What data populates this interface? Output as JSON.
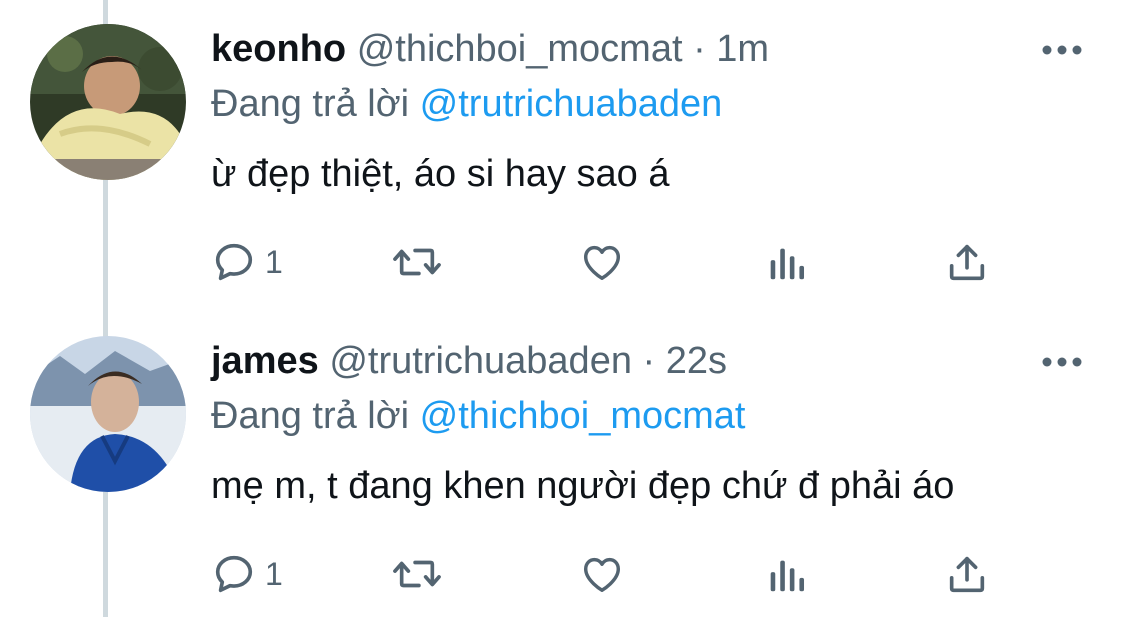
{
  "tweets": [
    {
      "name": "keonho",
      "handle": "@thichboi_mocmat",
      "separator": "·",
      "time": "1m",
      "replying_prefix": "Đang trả lời",
      "replying_to": "@trutrichuabaden",
      "text": "ừ đẹp thiệt, áo si hay sao á",
      "reply_count": "1",
      "avatar_colors": [
        "#3a4a2e",
        "#e8e0a0"
      ]
    },
    {
      "name": "james",
      "handle": "@trutrichuabaden",
      "separator": "·",
      "time": "22s",
      "replying_prefix": "Đang trả lời",
      "replying_to": "@thichboi_mocmat",
      "text": "mẹ m, t đang khen người đẹp chứ đ phải áo",
      "reply_count": "1",
      "avatar_colors": [
        "#8fa8c8",
        "#1f4fa8"
      ]
    }
  ],
  "icons": {
    "reply": "reply-icon",
    "retweet": "retweet-icon",
    "like": "like-icon",
    "views": "views-icon",
    "share": "share-icon",
    "more": "more-icon"
  },
  "colors": {
    "accent": "#1d9bf0",
    "muted": "#536471",
    "text": "#0f1419",
    "thread": "#cfd9de"
  }
}
